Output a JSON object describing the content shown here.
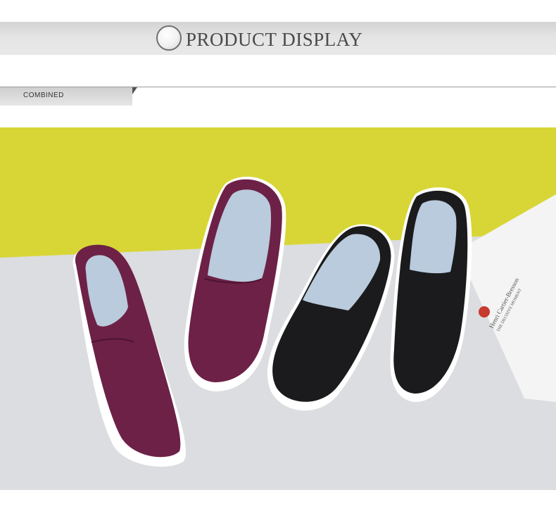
{
  "header": {
    "title": "PRODUCT DISPLAY"
  },
  "section": {
    "tag_label": "COMBINED"
  },
  "photo": {
    "description_icons": [
      "purple-shoe-icon",
      "black-shoe-icon",
      "card-icon"
    ],
    "colors": {
      "wall_yellow": "#d8d636",
      "floor_gray": "#dcdde0",
      "shoe_purple": "#6d2146",
      "shoe_black": "#1b1b1d",
      "insole_blue": "#b9cbdc"
    },
    "card": {
      "name": "Henri Cartier-Bresson",
      "subtitle": "THE DECISIVE MOMENT"
    }
  }
}
